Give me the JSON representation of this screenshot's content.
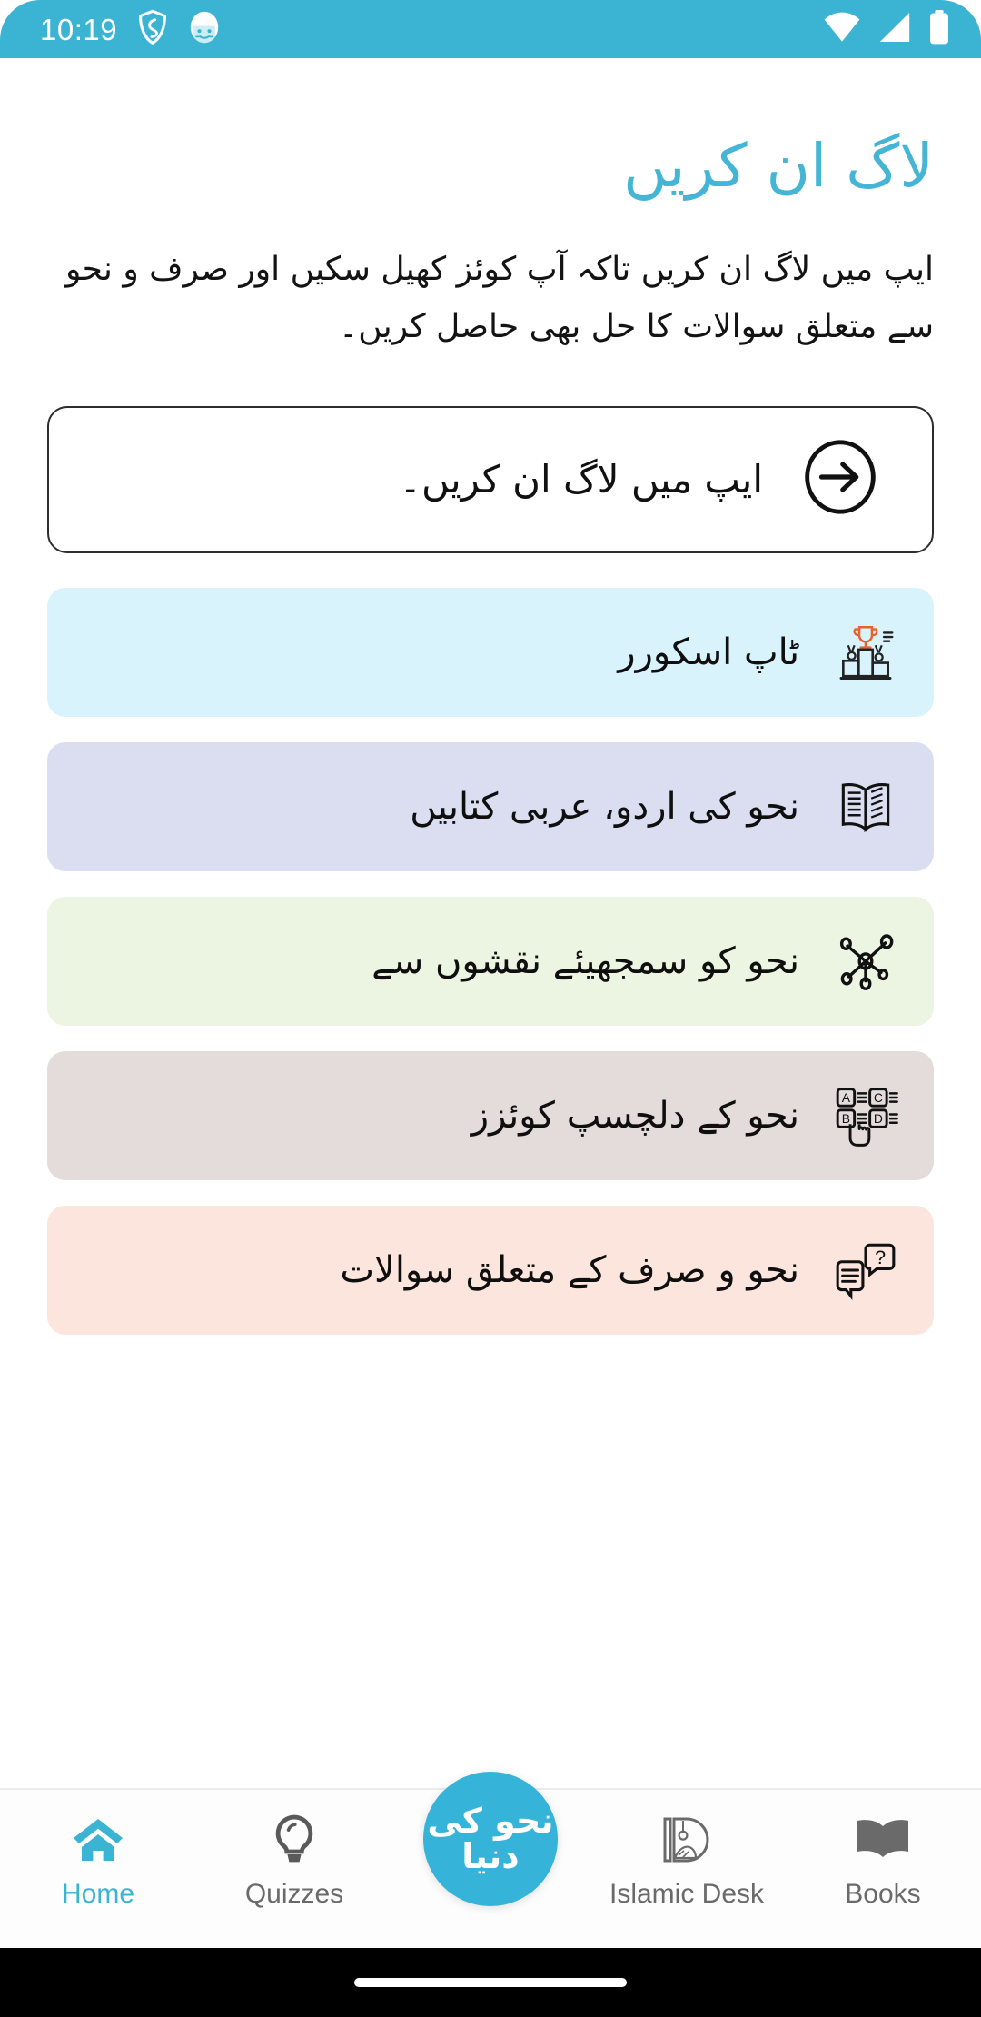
{
  "status_bar": {
    "clock": "10:19",
    "left_icons": [
      "shield-icon",
      "cat-face-icon"
    ],
    "right_icons": [
      "wifi-icon",
      "cellular-signal-icon",
      "battery-icon"
    ],
    "background_color": "#3bb4d4"
  },
  "header": {
    "title": "لاگ ان کریں",
    "title_color": "#45b5d6",
    "description": "ایپ میں لاگ ان کریں تاکہ آپ کوئز کھیل سکیں اور صرف و نحو سے متعلق سوالات کا حل بھی حاصل کریں۔"
  },
  "login_button": {
    "label": "ایپ میں لاگ ان کریں۔",
    "icon": "login-arrow-circle-icon",
    "border_color": "#2d2d2d"
  },
  "cards": [
    {
      "label": "ٹاپ اسکورر",
      "icon": "podium-trophy-icon",
      "bg_color": "#d9f3fc"
    },
    {
      "label": "نحو کی اردو، عربی کتابیں",
      "icon": "open-book-icon",
      "bg_color": "#dadef0"
    },
    {
      "label": "نحو کو سمجھیئے نقشوں سے",
      "icon": "node-network-icon",
      "bg_color": "#ecf4e2"
    },
    {
      "label": "نحو کے دلچسپ کوئزز",
      "icon": "mcq-quiz-icon",
      "bg_color": "#e3dcdb"
    },
    {
      "label": "نحو و صرف کے متعلق سوالات",
      "icon": "question-chat-icon",
      "bg_color": "#fce5dc"
    }
  ],
  "bottom_nav": {
    "active_color": "#3bb4d4",
    "inactive_color": "#6a6a6a",
    "items": [
      {
        "label": "Home",
        "icon": "home-icon",
        "active": true
      },
      {
        "label": "Quizzes",
        "icon": "lightbulb-icon",
        "active": false
      },
      {
        "label": "Islamic Desk",
        "icon": "islamic-desk-d-icon",
        "active": false
      },
      {
        "label": "Books",
        "icon": "books-open-icon",
        "active": false
      }
    ],
    "center_logo": {
      "text": "نحو کی دنیا",
      "bg_color": "#35b3d8"
    }
  }
}
